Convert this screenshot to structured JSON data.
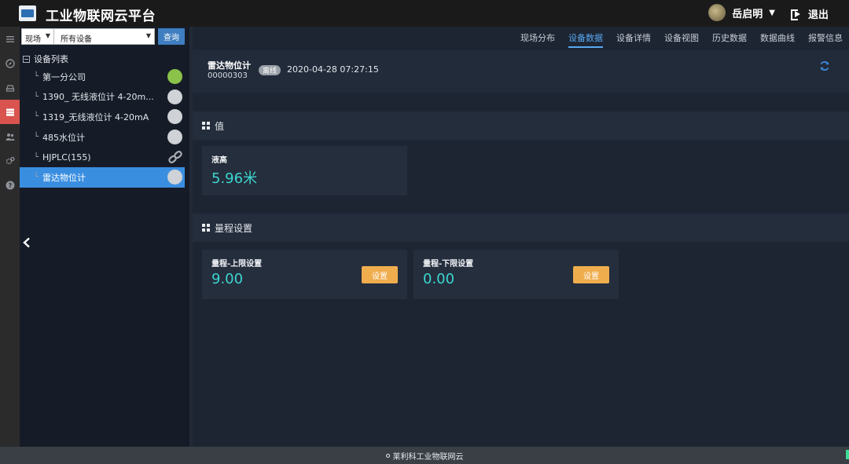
{
  "header": {
    "title": "工业物联网云平台",
    "user_name": "岳启明",
    "logout_label": "退出"
  },
  "rail": {
    "icons": [
      "menu-icon",
      "compass-icon",
      "drive-icon",
      "server-icon",
      "users-icon",
      "settings-icon",
      "help-icon"
    ],
    "active_index": 3
  },
  "filter": {
    "scope_value": "现场",
    "device_value": "所有设备",
    "query_label": "查询"
  },
  "tree": {
    "root_label": "设备列表",
    "items": [
      {
        "label": "第一分公司",
        "status": "online"
      },
      {
        "label": "1390_ 无线液位计 4-20m...",
        "status": "offline"
      },
      {
        "label": "1319_无线液位计 4-20mA",
        "status": "offline"
      },
      {
        "label": "485水位计",
        "status": "offline"
      },
      {
        "label": "HJPLC(155)",
        "status": "link"
      },
      {
        "label": "雷达物位计",
        "status": "offline",
        "selected": true
      }
    ]
  },
  "tabs": [
    {
      "label": "现场分布"
    },
    {
      "label": "设备数据",
      "active": true
    },
    {
      "label": "设备详情"
    },
    {
      "label": "设备视图"
    },
    {
      "label": "历史数据"
    },
    {
      "label": "数据曲线"
    },
    {
      "label": "报警信息"
    }
  ],
  "device": {
    "name": "雷达物位计",
    "code": "00000303",
    "status_badge": "离线",
    "timestamp": "2020-04-28 07:27:15"
  },
  "values_section": {
    "title": "值",
    "cards": [
      {
        "label": "液高",
        "value": "5.96米"
      }
    ]
  },
  "range_section": {
    "title": "量程设置",
    "cards": [
      {
        "label": "量程-上限设置",
        "value": "9.00",
        "button": "设置"
      },
      {
        "label": "量程-下限设置",
        "value": "0.00",
        "button": "设置"
      }
    ]
  },
  "footer": {
    "text": "莱利科工业物联网云"
  },
  "colors": {
    "accent": "#3a8ee0",
    "value_teal": "#3bd6d0",
    "button_orange": "#f0ad4e",
    "online_green": "#8bc34a",
    "rail_active": "#d9534f"
  }
}
